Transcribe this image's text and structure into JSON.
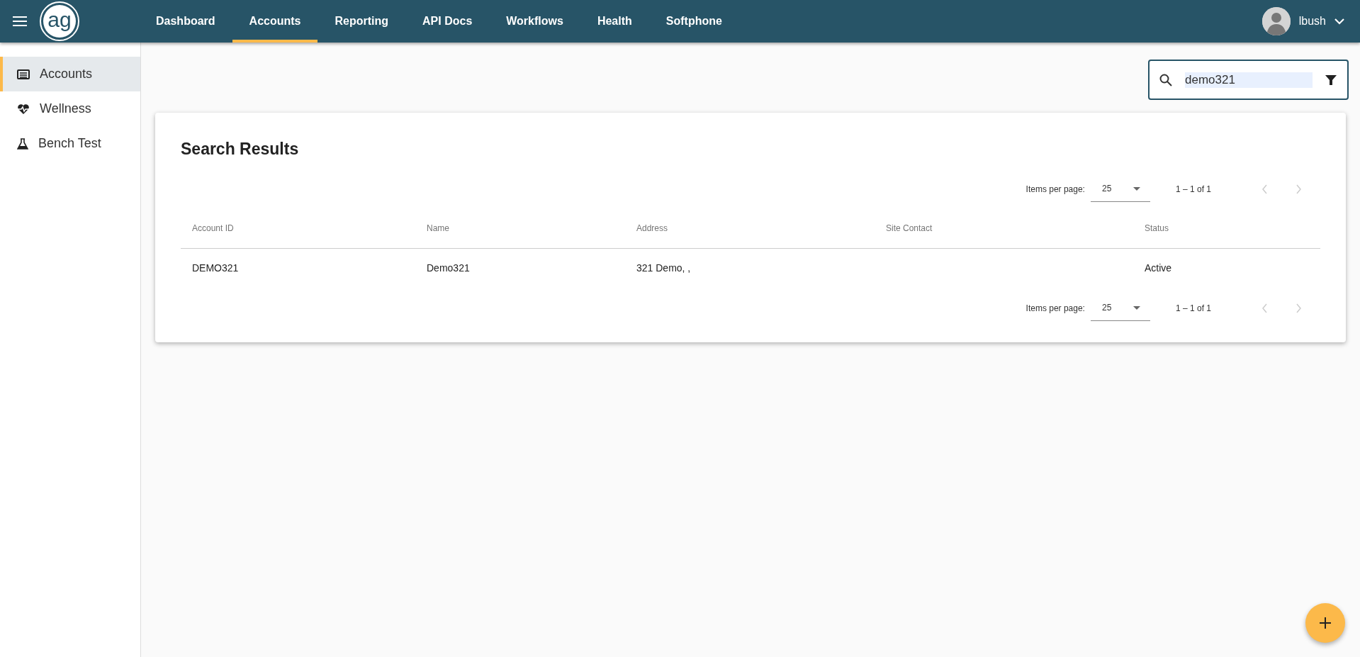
{
  "topbar": {
    "logo_text": "ag",
    "tabs": [
      {
        "label": "Dashboard",
        "selected": false
      },
      {
        "label": "Accounts",
        "selected": true
      },
      {
        "label": "Reporting",
        "selected": false
      },
      {
        "label": "API Docs",
        "selected": false
      },
      {
        "label": "Workflows",
        "selected": false
      },
      {
        "label": "Health",
        "selected": false
      },
      {
        "label": "Softphone",
        "selected": false
      }
    ],
    "user": {
      "name": "lbush"
    }
  },
  "sidebar": {
    "items": [
      {
        "label": "Accounts",
        "kind": "list",
        "selected": true
      },
      {
        "label": "Wellness",
        "kind": "heart",
        "selected": false
      },
      {
        "label": "Bench Test",
        "kind": "flask",
        "selected": false
      }
    ]
  },
  "search": {
    "value": "demo321"
  },
  "results": {
    "title": "Search Results",
    "paginators": [
      {
        "label": "Items per page:",
        "page_size": "25",
        "range": "1 – 1 of 1",
        "prev_disabled": true,
        "next_disabled": true
      },
      {
        "label": "Items per page:",
        "page_size": "25",
        "range": "1 – 1 of 1",
        "prev_disabled": true,
        "next_disabled": true
      }
    ],
    "columns": [
      "Account ID",
      "Name",
      "Address",
      "Site Contact",
      "Status"
    ],
    "rows": [
      [
        "DEMO321",
        "Demo321",
        "321 Demo, ,",
        "",
        "Active"
      ]
    ]
  }
}
